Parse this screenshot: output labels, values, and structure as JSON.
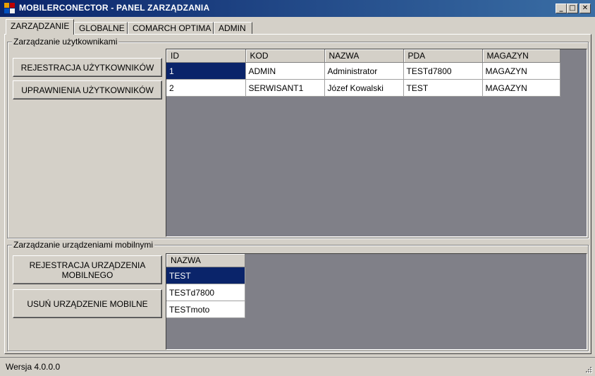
{
  "window": {
    "title": "MOBILERCONECTOR - PANEL ZARZĄDZANIA",
    "icon": "app-window-icon",
    "controls": {
      "minimize": "_",
      "maximize": "□",
      "close": "✕"
    }
  },
  "tabs": [
    {
      "label": "ZARZĄDZANIE",
      "active": true
    },
    {
      "label": "GLOBALNE",
      "active": false
    },
    {
      "label": "COMARCH OPTIMA",
      "active": false
    },
    {
      "label": "ADMIN",
      "active": false
    }
  ],
  "users_group": {
    "title": "Zarządzanie użytkownikami",
    "buttons": {
      "register": "REJESTRACJA UŻYTKOWNIKÓW",
      "permissions": "UPRAWNIENIA UŻYTKOWNIKÓW"
    },
    "table": {
      "columns": [
        "ID",
        "KOD",
        "NAZWA",
        "PDA",
        "MAGAZYN"
      ],
      "rows": [
        [
          "1",
          "ADMIN",
          "Administrator",
          "TESTd7800",
          "MAGAZYN"
        ],
        [
          "2",
          "SERWISANT1",
          "Józef Kowalski",
          "TEST",
          "MAGAZYN"
        ]
      ],
      "selected_row": 0
    }
  },
  "devices_group": {
    "title": "Zarządzanie urządzeniami mobilnymi",
    "buttons": {
      "register": "REJESTRACJA URZĄDZENIA\nMOBILNEGO",
      "remove": "USUŃ URZĄDZENIE MOBILNE"
    },
    "table": {
      "columns": [
        "NAZWA"
      ],
      "rows": [
        [
          "TEST"
        ],
        [
          "TESTd7800"
        ],
        [
          "TESTmoto"
        ]
      ],
      "selected_row": 0
    }
  },
  "status": {
    "version": "Wersja 4.0.0.0"
  },
  "colors": {
    "title_start": "#0a246a",
    "title_end": "#3a6ea5",
    "selection": "#0a246a",
    "grid_bg": "#808088",
    "face": "#d4d0c8"
  }
}
